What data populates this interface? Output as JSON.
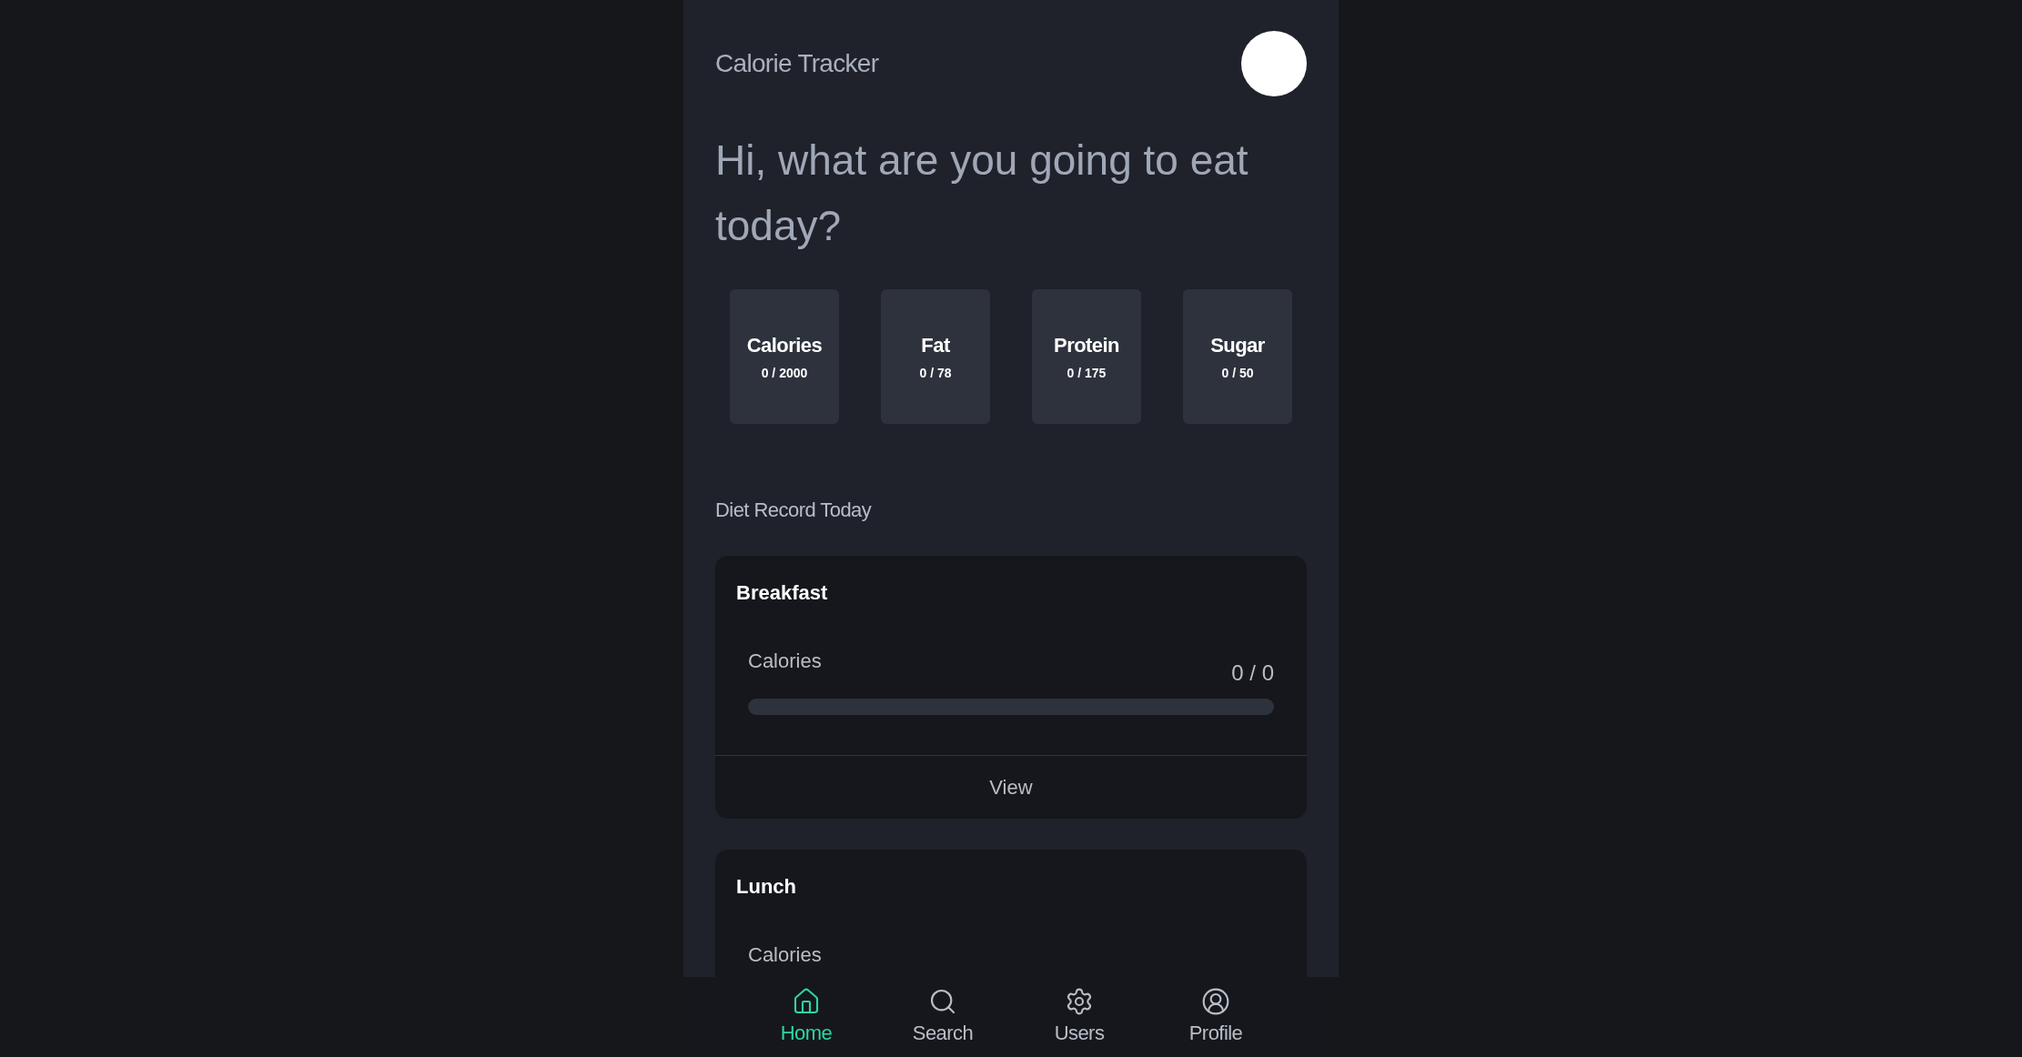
{
  "header": {
    "title": "Calorie Tracker"
  },
  "greeting": "Hi, what are you going to eat today?",
  "stats": [
    {
      "label": "Calories",
      "value": "0 / 2000"
    },
    {
      "label": "Fat",
      "value": "0 / 78"
    },
    {
      "label": "Protein",
      "value": "0 / 175"
    },
    {
      "label": "Sugar",
      "value": "0 / 50"
    }
  ],
  "section_title": "Diet Record Today",
  "meals": [
    {
      "title": "Breakfast",
      "metric": "Calories",
      "reading": "0 / 0",
      "level": 0,
      "action": "View"
    },
    {
      "title": "Lunch",
      "metric": "Calories"
    }
  ],
  "nav": [
    {
      "label": "Home",
      "kind": "home",
      "selected": true
    },
    {
      "label": "Search",
      "kind": "search",
      "selected": false
    },
    {
      "label": "Users",
      "kind": "gear",
      "selected": false
    },
    {
      "label": "Profile",
      "kind": "profile",
      "selected": false
    }
  ]
}
